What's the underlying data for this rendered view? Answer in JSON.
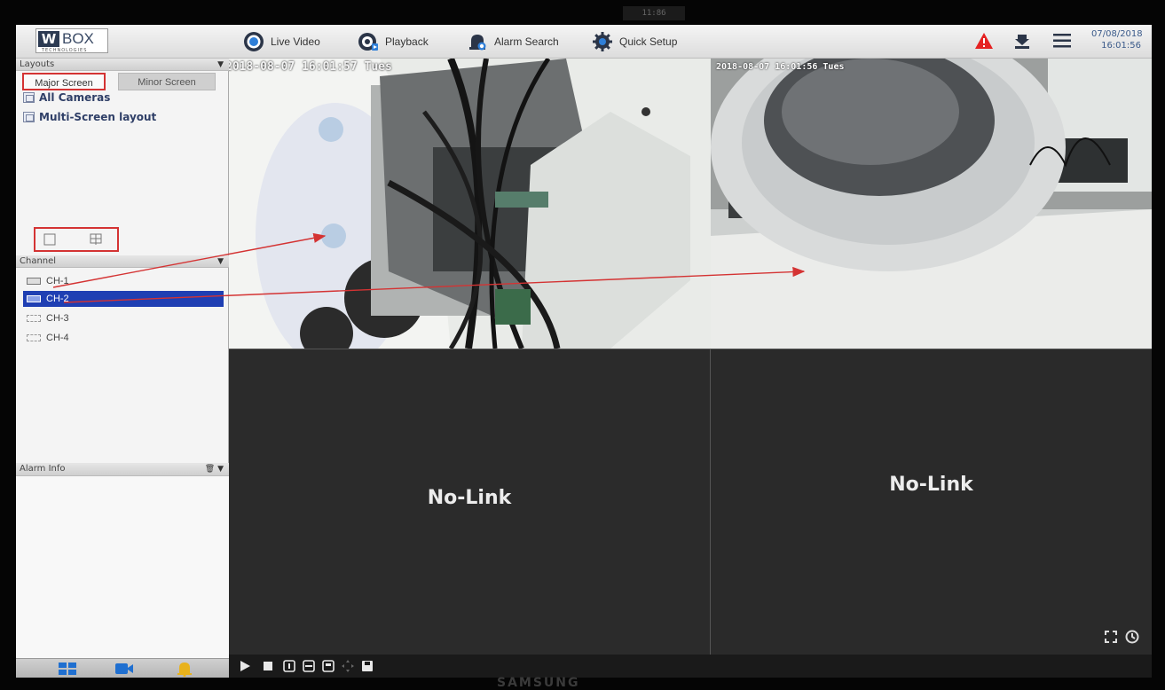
{
  "bezel_note": "11:86",
  "maker": "SAMSUNG",
  "app": {
    "logo_w": "W",
    "logo_box": "BOX",
    "logo_tagline": "TECHNOLOGIES"
  },
  "nav": {
    "live_video": "Live Video",
    "playback": "Playback",
    "alarm_search": "Alarm Search",
    "quick_setup": "Quick Setup"
  },
  "clock": {
    "date": "07/08/2018",
    "time": "16:01:56"
  },
  "colors": {
    "accent_blue": "#1f3fb3",
    "annotation_red": "#d43333",
    "alarm_red": "#e52222"
  },
  "sidebar": {
    "layouts_header": "Layouts",
    "tabs": [
      {
        "label": "Major Screen",
        "active": true
      },
      {
        "label": "Minor Screen",
        "active": false
      }
    ],
    "tree": [
      {
        "label": "All Cameras"
      },
      {
        "label": "Multi-Screen layout"
      }
    ],
    "channel_header": "Channel",
    "channels": [
      {
        "label": "CH-1",
        "state": "live"
      },
      {
        "label": "CH-2",
        "state": "selected"
      },
      {
        "label": "CH-3",
        "state": "offline"
      },
      {
        "label": "CH-4",
        "state": "offline"
      }
    ],
    "alarm_header": "Alarm Info"
  },
  "tiles": [
    {
      "osd": "2018-08-07 16:01:57 Tues",
      "status": ""
    },
    {
      "osd": "2018-08-07 16:01:56 Tues",
      "status": ""
    },
    {
      "osd": "",
      "status": "No-Link"
    },
    {
      "osd": "",
      "status": "No-Link"
    }
  ],
  "icons": {
    "live_video": "record-icon",
    "playback": "playback-icon",
    "alarm_search": "alarm-search-icon",
    "quick_setup": "gear-icon",
    "alarm": "warning-icon",
    "download": "download-icon",
    "menu": "hamburger-menu-icon"
  }
}
